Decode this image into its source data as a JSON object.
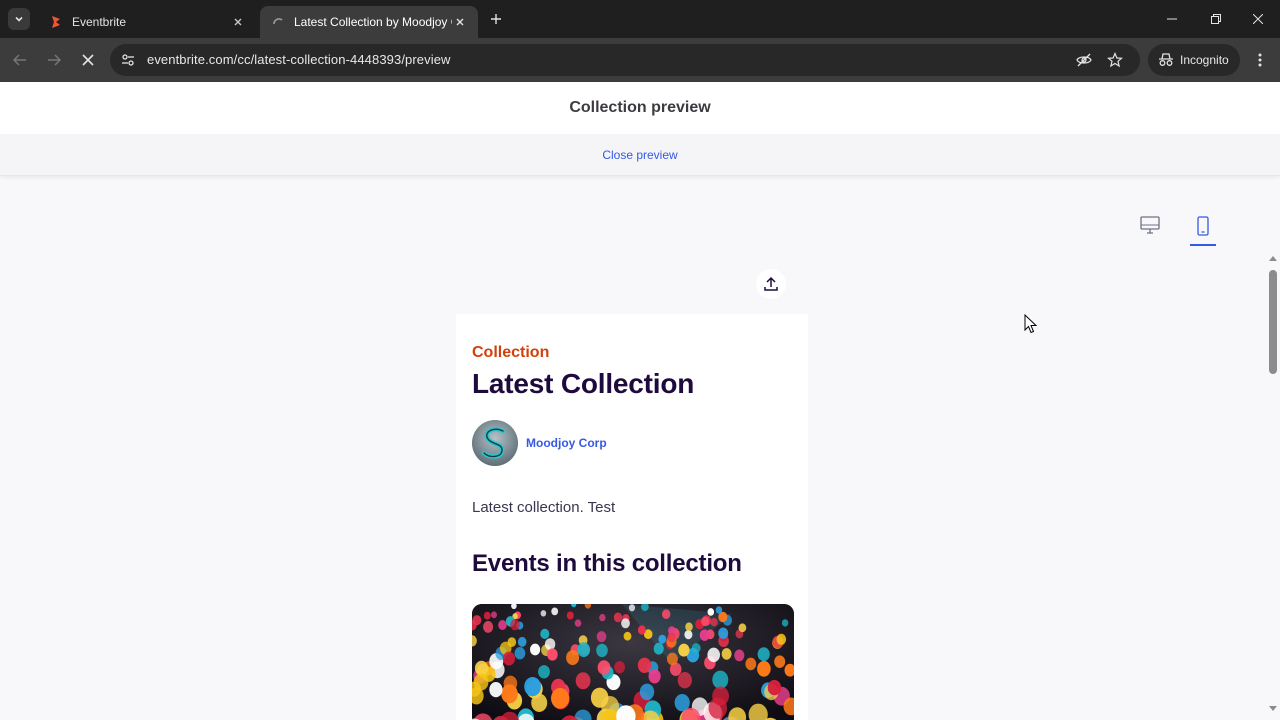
{
  "browser": {
    "tabs": [
      {
        "title": "Eventbrite",
        "active": false
      },
      {
        "title": "Latest Collection by Moodjoy C",
        "active": true
      }
    ],
    "url": "eventbrite.com/cc/latest-collection-4448393/preview",
    "incognito_label": "Incognito"
  },
  "page": {
    "header_title": "Collection preview",
    "close_preview_label": "Close preview",
    "view_modes": [
      "desktop",
      "mobile"
    ],
    "selected_view": "mobile"
  },
  "collection": {
    "eyebrow": "Collection",
    "title": "Latest Collection",
    "organizer": "Moodjoy Corp",
    "description": "Latest collection. Test",
    "events_heading": "Events in this collection"
  },
  "colors": {
    "accent_blue": "#3659e3",
    "eyebrow_orange": "#d1410c",
    "heading_navy": "#1e0a3c"
  }
}
